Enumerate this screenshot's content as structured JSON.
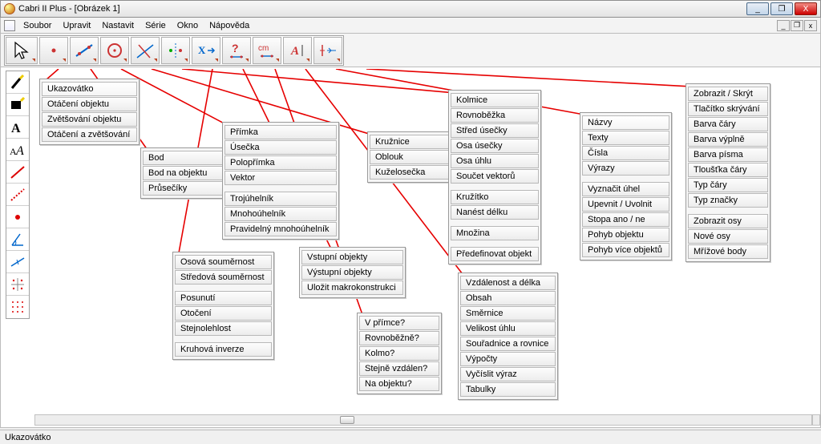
{
  "window": {
    "title": "Cabri II Plus - [Obrázek 1]",
    "win_buttons": {
      "min": "_",
      "max": "❐",
      "close": "X"
    },
    "mdi_buttons": {
      "min": "_",
      "max": "❐",
      "close": "x"
    }
  },
  "menubar": {
    "items": [
      {
        "label": "Soubor"
      },
      {
        "label": "Upravit"
      },
      {
        "label": "Nastavit"
      },
      {
        "label": "Série"
      },
      {
        "label": "Okno"
      },
      {
        "label": "Nápověda"
      }
    ]
  },
  "statusbar": {
    "text": "Ukazovátko"
  },
  "toolbar_menus": {
    "pointer": [
      "Ukazovátko",
      "Otáčení objektu",
      "Zvětšování objektu",
      "Otáčení a zvětšování"
    ],
    "point": [
      "Bod",
      "Bod na objektu",
      "Průsečíky"
    ],
    "line": [
      "Přímka",
      "Úsečka",
      "Polopřímka",
      "Vektor",
      "Trojúhelník",
      "Mnohoúhelník",
      "Pravidelný mnohoúhelník"
    ],
    "circle": [
      "Kružnice",
      "Oblouk",
      "Kuželosečka"
    ],
    "construct": [
      "Kolmice",
      "Rovnoběžka",
      "Střed úsečky",
      "Osa úsečky",
      "Osa úhlu",
      "Součet vektorů",
      "Kružítko",
      "Nanést délku",
      "Množina",
      "Předefinovat objekt"
    ],
    "transform": [
      "Osová souměrnost",
      "Středová souměrnost",
      "Posunutí",
      "Otočení",
      "Stejnolehlost",
      "Kruhová inverze"
    ],
    "macro": [
      "Vstupní objekty",
      "Výstupní objekty",
      "Uložit makrokonstrukci"
    ],
    "query": [
      "V přímce?",
      "Rovnoběžně?",
      "Kolmo?",
      "Stejně vzdálen?",
      "Na objektu?"
    ],
    "measure": [
      "Vzdálenost a délka",
      "Obsah",
      "Směrnice",
      "Velikost úhlu",
      "Souřadnice a rovnice",
      "Výpočty",
      "Vyčíslit výraz",
      "Tabulky"
    ],
    "text": [
      "Názvy",
      "Texty",
      "Čísla",
      "Výrazy",
      "Vyznačit úhel",
      "Upevnit / Uvolnit",
      "Stopa ano / ne",
      "Pohyb objektu",
      "Pohyb více objektů"
    ],
    "style": [
      "Zobrazit / Skrýt",
      "Tlačítko skrývání",
      "Barva čáry",
      "Barva výplně",
      "Barva písma",
      "Tloušťka čáry",
      "Typ čáry",
      "Typ značky",
      "Zobrazit osy",
      "Nové osy",
      "Mřížové body"
    ]
  }
}
